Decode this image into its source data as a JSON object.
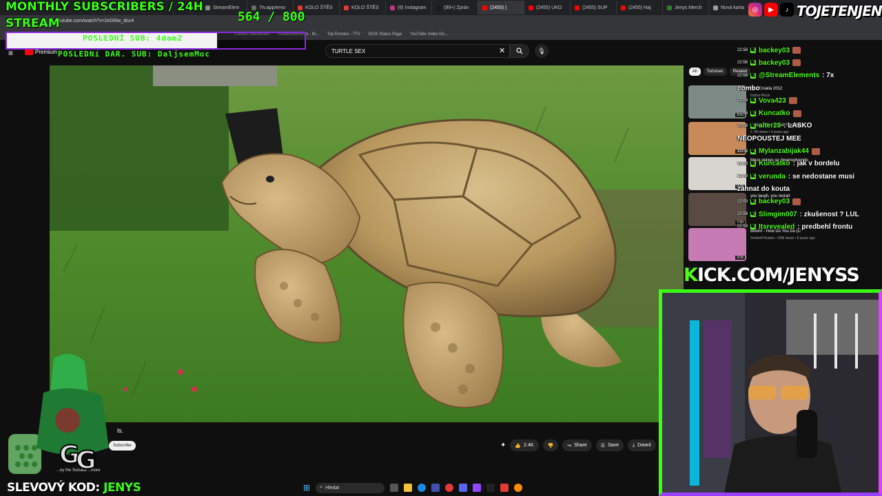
{
  "overlay": {
    "title_line1": "MONTHLY SUBSCRIBERS / 24H",
    "title_line2": "STREAM",
    "sub_count": "564 / 800",
    "sub_progress": 0.705,
    "last_sub": "POSLEDNÍ SUB: 4dam2",
    "last_donation": "POSLEDNí DAR. SUB: DaljsemMoc",
    "kick_url_k": "K",
    "kick_url_rest": "ICK.COM/JENYSS",
    "handle": "TOJETENJENYS",
    "promo_label": "SLEVOVÝ KOD:",
    "promo_code": "JENYS"
  },
  "browser": {
    "url": "youtube.com/watch?v=2eDi0w_doz4",
    "tabs": [
      {
        "label": "StreamElem",
        "color": "#8a8a8a"
      },
      {
        "label": "7tv.app/emo",
        "color": "#6a6a6a"
      },
      {
        "label": "KOLO ŠTĚS",
        "color": "#e53935"
      },
      {
        "label": "KOLO ŠTĚS",
        "color": "#e53935"
      },
      {
        "label": "(6) Instagram",
        "color": "#c13584"
      },
      {
        "label": "(99+) Zpráv",
        "color": "#1a1a1a"
      },
      {
        "label": "(2455) |",
        "color": "#ff0000"
      },
      {
        "label": "(2455) UKO",
        "color": "#ff0000"
      },
      {
        "label": "(2455) SUP",
        "color": "#ff0000"
      },
      {
        "label": "(2455) Naj",
        "color": "#ff0000"
      },
      {
        "label": "Jenys Merch",
        "color": "#2e7d32"
      },
      {
        "label": "Nová karta",
        "color": "#9e9e9e"
      }
    ],
    "bookmarks": [
      "Creator Dashboard",
      "StreamElements - M...",
      "Top Emotes - 7TV",
      "KICK Status Page",
      "YouTube Video Do..."
    ]
  },
  "youtube": {
    "premium_label": "Premium",
    "search_query": "TURTLE SEX",
    "title_fragment": "ls.",
    "subscribe_label": "Subscribe",
    "description": "...ey the Sulcata ...more",
    "likes": "2.4K",
    "share_label": "Share",
    "save_label": "Save",
    "download_label": "Downl",
    "chips": [
      "All",
      "Tortoises",
      "Related"
    ],
    "recommendations": [
      {
        "title": "Sex Croatia 2012",
        "meta": "Dzibor Pecin",
        "duration": "3:55"
      },
      {
        "title": "music video | prod. Speaker",
        "meta": "1.7M views • 4 years ago",
        "duration": "3:01"
      },
      {
        "title": "Meus peixes se desenvolvendo",
        "meta": "",
        "duration": "0:39"
      },
      {
        "title": "you laugh, you restart",
        "meta": "",
        "duration": "7:50"
      },
      {
        "title": "Boom! - How Do You Do (C",
        "meta": "Smilnoff Ruslan • 15M views • 8 years ago",
        "duration": "3:35"
      }
    ]
  },
  "chat": [
    {
      "time": "22:58",
      "user": "backey03",
      "msg": ""
    },
    {
      "time": "22:58",
      "user": "backey03",
      "msg": ""
    },
    {
      "time": "22:58",
      "user": "@StreamElements",
      "msg": ": 7x"
    },
    {
      "time": "",
      "user": "",
      "msg": "combo"
    },
    {
      "time": "22:58",
      "user": "Vova423",
      "msg": ""
    },
    {
      "time": "22:58",
      "user": "Kuncatko",
      "msg": ""
    },
    {
      "time": "22:58",
      "user": "alter23",
      "msg": ": LASKO"
    },
    {
      "time": "",
      "user": "",
      "msg": "NEOPOUSTEJ MEE"
    },
    {
      "time": "22:58",
      "user": "Mylanzabijak44",
      "msg": ""
    },
    {
      "time": "22:59",
      "user": "Kuncatko",
      "msg": ": jak v bordelu"
    },
    {
      "time": "22:59",
      "user": "verunda",
      "msg": ": se nedostane musi"
    },
    {
      "time": "",
      "user": "",
      "msg": "zahnat do kouta"
    },
    {
      "time": "22:59",
      "user": "backey03",
      "msg": ""
    },
    {
      "time": "22:59",
      "user": "Slimgim007",
      "msg": ": zkušenost ? LUL"
    },
    {
      "time": "22:59",
      "user": "Itsrevealed",
      "msg": ": predbehl frontu"
    }
  ],
  "taskbar": {
    "search_label": "Hledat"
  },
  "colors": {
    "overlay_green": "#39ff14",
    "kick_green": "#53fc18",
    "accent_purple": "#8a2be2",
    "youtube_red": "#ff0000"
  }
}
